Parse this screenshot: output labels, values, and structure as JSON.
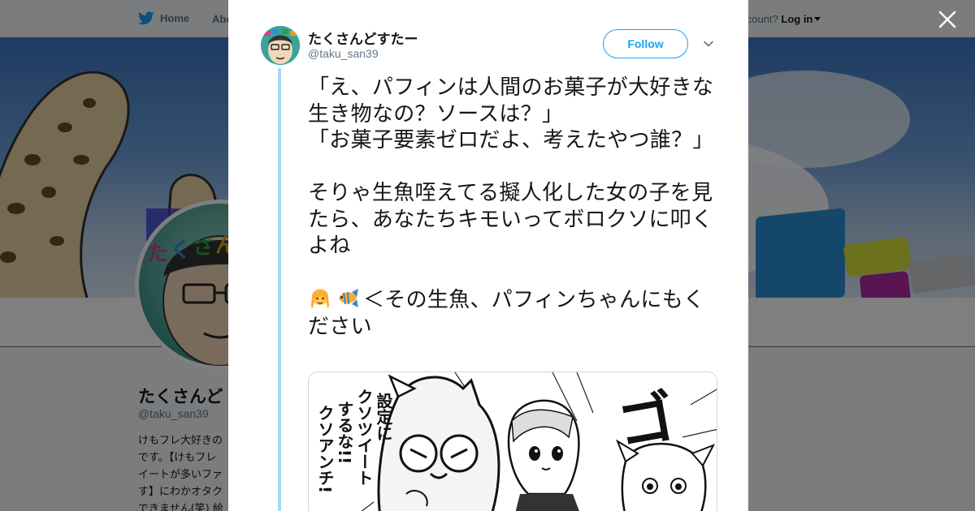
{
  "background_page": {
    "nav": {
      "home_label": "Home",
      "about_label": "Abo",
      "account_prompt": "account?",
      "login_label": "Log in"
    },
    "profile": {
      "name": "たくさんど",
      "handle": "@taku_san39",
      "bio_lines": [
        "けもフレ大好きの",
        "です。【けもフレ",
        "イートが多いファ",
        "す】にわかオタク",
        "できません(笑) 絵"
      ]
    }
  },
  "tweet": {
    "author_name": "たくさんどすたー",
    "author_handle": "@taku_san39",
    "follow_label": "Follow",
    "text": "「え、パフィンは人間のお菓子が大好きな生き物なの？ソースは？」\n「お菓子要素ゼロだよ、考えたやつ誰？」\n\nそりゃ生魚咥えてる擬人化した女の子を見たら、あなたちキモいってボロクソに叩くよね\n\n",
    "emoji_line_text": "＜その生魚、パフィンちゃんにもください",
    "emoji_icons": [
      "girl-emoji",
      "tropical-fish-emoji"
    ],
    "image": {
      "caption_vertical_1": "設定に",
      "caption_vertical_2": "クソツイート",
      "caption_vertical_3": "するな!!",
      "caption_vertical_4": "クソアンチ!",
      "sfx": "ゴ"
    }
  },
  "colors": {
    "accent": "#1da1f2",
    "thread_line": "#a6d8f8",
    "text": "#14171a",
    "muted": "#657786"
  }
}
